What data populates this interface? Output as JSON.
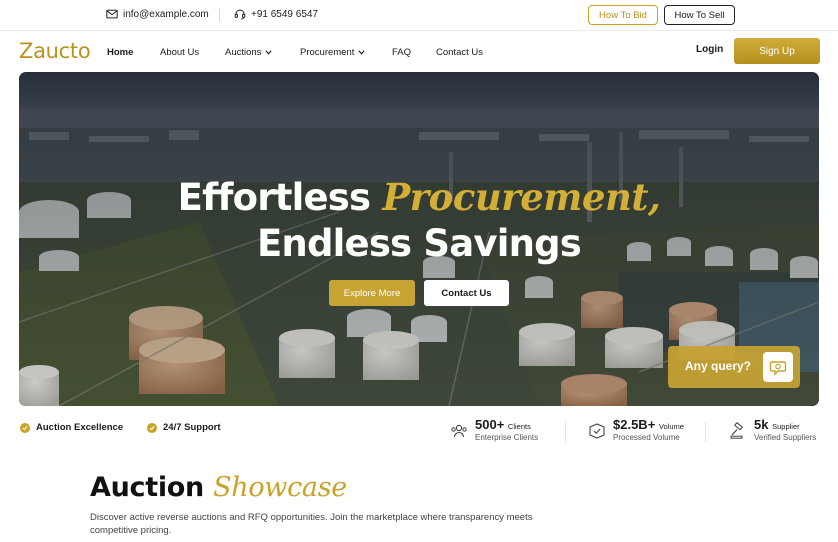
{
  "topbar": {
    "email": "info@example.com",
    "phone": "+91 6549 6547",
    "how_to_bid": "How To Bid",
    "how_to_sell": "How To Sell"
  },
  "nav": {
    "logo": "Zaucto",
    "items": [
      {
        "label": "Home",
        "active": true
      },
      {
        "label": "About Us"
      },
      {
        "label": "Auctions",
        "dropdown": true
      },
      {
        "label": "Procurement",
        "dropdown": true
      },
      {
        "label": "FAQ"
      },
      {
        "label": "Contact Us"
      }
    ],
    "login": "Login",
    "signup": "Sign Up"
  },
  "hero": {
    "line1_plain": "Effortless ",
    "line1_gold": "Procurement,",
    "line2": "Endless Savings",
    "explore_label": "Explore More",
    "contact_label": "Contact Us",
    "query_label": "Any query?"
  },
  "badges": [
    "Auction Excellence",
    "24/7 Support"
  ],
  "stats": [
    {
      "value": "500+",
      "unit": "Clients",
      "sub": "Enterprise Clients",
      "icon": "users-icon"
    },
    {
      "value": "$2.5B+",
      "unit": "Volume",
      "sub": "Processed Volume",
      "icon": "box-check-icon"
    },
    {
      "value": "5k",
      "unit": "Supplier",
      "sub": "Verified Suppliers",
      "icon": "gavel-icon"
    }
  ],
  "showcase": {
    "title_plain": "Auction ",
    "title_gold": "Showcase",
    "description": "Discover active reverse auctions and RFQ opportunities. Join the marketplace where transparency meets competitive pricing."
  },
  "colors": {
    "gold": "#c9a227",
    "dark": "#1b1b1b"
  }
}
